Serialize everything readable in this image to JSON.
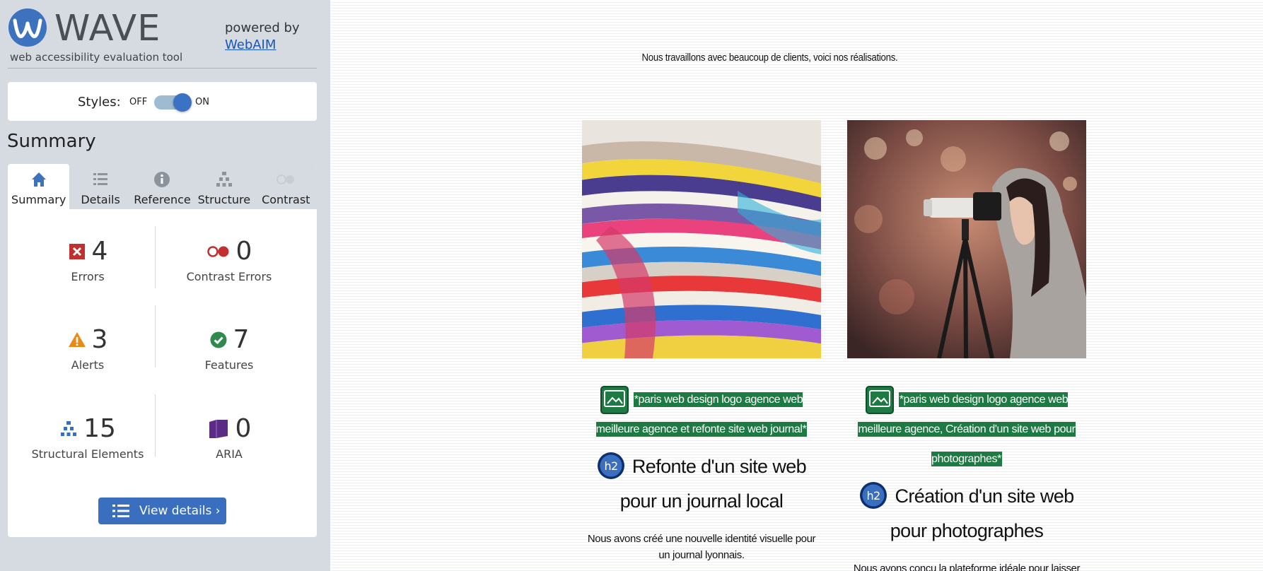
{
  "wave": {
    "title": "WAVE",
    "subtitle": "web accessibility evaluation tool",
    "powered_by": "powered by",
    "webaim": "WebAIM"
  },
  "styles": {
    "label": "Styles:",
    "off": "OFF",
    "on": "ON",
    "enabled": true
  },
  "summary_heading": "Summary",
  "tabs": [
    {
      "label": "Summary",
      "icon": "home-icon",
      "active": true
    },
    {
      "label": "Details",
      "icon": "list-icon",
      "active": false
    },
    {
      "label": "Reference",
      "icon": "info-icon",
      "active": false
    },
    {
      "label": "Structure",
      "icon": "structure-icon",
      "active": false
    },
    {
      "label": "Contrast",
      "icon": "contrast-icon",
      "active": false
    }
  ],
  "stats": {
    "errors": {
      "value": "4",
      "label": "Errors"
    },
    "contrast_errors": {
      "value": "0",
      "label": "Contrast Errors"
    },
    "alerts": {
      "value": "3",
      "label": "Alerts"
    },
    "features": {
      "value": "7",
      "label": "Features"
    },
    "structural": {
      "value": "15",
      "label": "Structural Elements"
    },
    "aria": {
      "value": "0",
      "label": "ARIA"
    }
  },
  "view_details": "View details ›",
  "colors": {
    "error": "#c22f2f",
    "alert": "#e88a14",
    "feature": "#2f8a4e",
    "structure": "#3a6fbf",
    "aria": "#5b2c86",
    "accent": "#3a6fbf",
    "alt_highlight": "#1e7a43"
  },
  "page": {
    "intro": "Nous travaillons avec beaucoup de clients, voici nos réalisations.",
    "cards": [
      {
        "image": "stacked-magazines-photo",
        "alt": "*paris web design logo agence web meilleure agence et refonte site web journal*",
        "title": "Refonte d'un site web pour un journal local",
        "desc": "Nous avons créé une nouvelle identité visuelle pour un journal lyonnais."
      },
      {
        "image": "photographer-with-camera-photo",
        "alt": "*paris web design logo agence web meilleure agence, Création d'un site web pour photographes*",
        "title": "Création d'un site web pour photographes",
        "desc": "Nous avons conçu la plateforme idéale pour laisser place aux clichés des photographes."
      }
    ]
  }
}
